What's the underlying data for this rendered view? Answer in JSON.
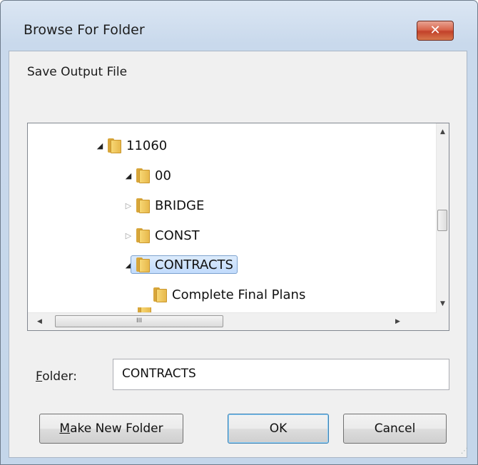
{
  "window": {
    "title": "Browse For Folder",
    "close_glyph": "✕"
  },
  "prompt": "Save Output File",
  "tree": {
    "items": [
      {
        "label": "11060",
        "expander": "◢",
        "depth": 0
      },
      {
        "label": "00",
        "expander": "◢",
        "depth": 1
      },
      {
        "label": "BRIDGE",
        "expander": "▷",
        "depth": 2
      },
      {
        "label": "CONST",
        "expander": "▷",
        "depth": 2
      },
      {
        "label": "CONTRACTS",
        "expander": "◢",
        "depth": 2,
        "selected": true
      },
      {
        "label": "Complete Final Plans",
        "expander": "",
        "depth": 3
      }
    ],
    "scroll_up_glyph": "▲",
    "scroll_down_glyph": "▼",
    "scroll_left_glyph": "◀",
    "scroll_right_glyph": "▶",
    "hthumb_grip": "III"
  },
  "folder_field": {
    "label_prefix": "F",
    "label_rest": "older:",
    "value": "CONTRACTS"
  },
  "buttons": {
    "make_new_prefix": "M",
    "make_new_rest": "ake New Folder",
    "ok": "OK",
    "cancel": "Cancel"
  },
  "colors": {
    "selection": "#c1dbfc",
    "close": "#c2412a",
    "folder": "#f7d774"
  }
}
